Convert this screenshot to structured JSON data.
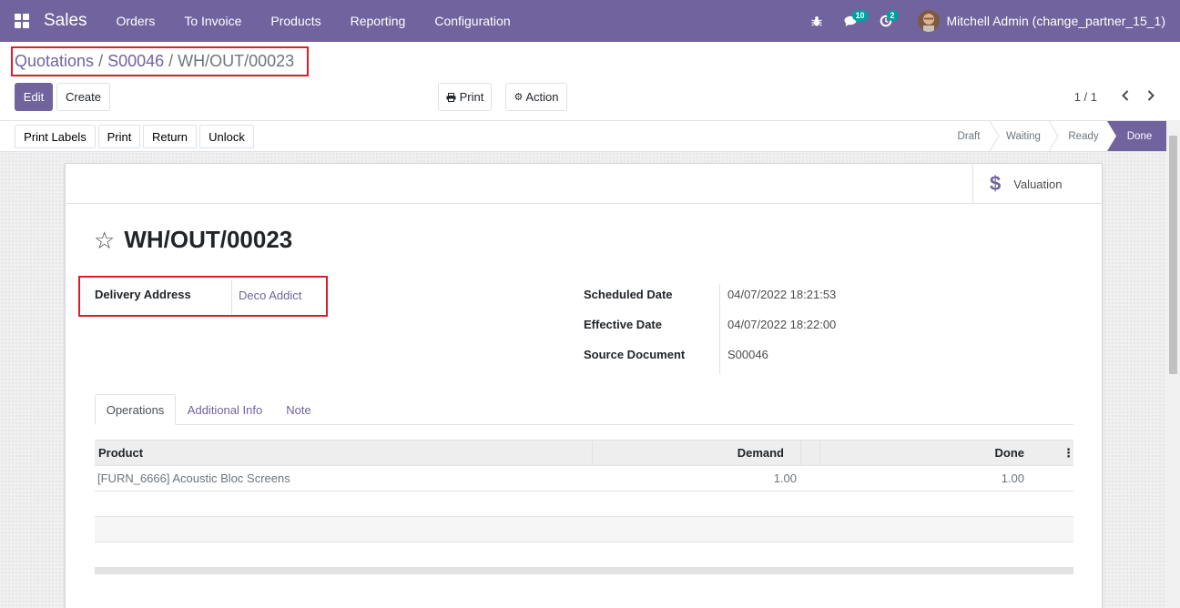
{
  "navbar": {
    "app_name": "Sales",
    "menu": [
      "Orders",
      "To Invoice",
      "Products",
      "Reporting",
      "Configuration"
    ],
    "messages_badge": "10",
    "activities_badge": "2",
    "user_name": "Mitchell Admin (change_partner_15_1)",
    "bar_color": "#71639e"
  },
  "breadcrumb": {
    "items": [
      "Quotations",
      "S00046"
    ],
    "separator": "/",
    "current": "WH/OUT/00023"
  },
  "controls": {
    "edit_label": "Edit",
    "create_label": "Create",
    "print_label": "Print",
    "action_label": "Action",
    "pager": "1 / 1"
  },
  "statusbar": {
    "buttons": [
      "Print Labels",
      "Print",
      "Return",
      "Unlock"
    ],
    "stages": [
      "Draft",
      "Waiting",
      "Ready",
      "Done"
    ],
    "current_stage": "Done"
  },
  "sheet": {
    "valuation_label": "Valuation",
    "title": "WH/OUT/00023",
    "fields_left": [
      {
        "label": "Delivery Address",
        "value": "Deco Addict"
      }
    ],
    "fields_right": [
      {
        "label": "Scheduled Date",
        "value": "04/07/2022 18:21:53"
      },
      {
        "label": "Effective Date",
        "value": "04/07/2022 18:22:00"
      },
      {
        "label": "Source Document",
        "value": "S00046"
      }
    ],
    "tabs": [
      "Operations",
      "Additional Info",
      "Note"
    ],
    "active_tab": "Operations",
    "table": {
      "columns": [
        "Product",
        "Demand",
        "Done"
      ],
      "rows": [
        {
          "product": "[FURN_6666] Acoustic Bloc Screens",
          "demand": "1.00",
          "done": "1.00"
        }
      ]
    }
  }
}
